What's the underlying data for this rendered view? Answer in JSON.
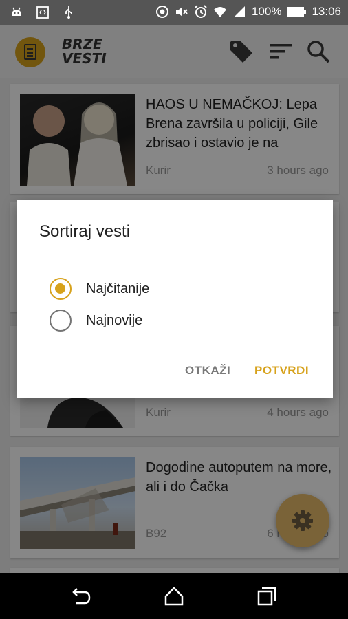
{
  "status_bar": {
    "battery": "100%",
    "time": "13:06",
    "icons": [
      "android-debug-icon",
      "code-icon",
      "usb-icon",
      "data-saver-icon",
      "mute-icon",
      "alarm-icon",
      "wifi-icon",
      "signal-icon",
      "battery-icon"
    ]
  },
  "app_bar": {
    "brand_line1": "BRZE",
    "brand_line2": "VESTI",
    "icons": [
      "app-logo-icon",
      "tag-icon",
      "sort-icon",
      "search-icon"
    ]
  },
  "feed": {
    "items": [
      {
        "headline": "HAOS U NEMAČKOJ: Lepa Brena završila u policiji, Gile zbrisao i ostavio je na",
        "source": "Kurir",
        "time": "3 hours ago"
      },
      {
        "headline": "",
        "source": "Kurir",
        "time": "4 hours ago"
      },
      {
        "headline": "Dogodine autoputem na more, ali i do Čačka",
        "source": "B92",
        "time": "6 hours ago"
      }
    ]
  },
  "dialog": {
    "title": "Sortiraj vesti",
    "options": [
      {
        "label": "Najčitanije",
        "selected": true
      },
      {
        "label": "Najnovije",
        "selected": false
      }
    ],
    "cancel_label": "OTKAŽI",
    "confirm_label": "POTVRDI"
  },
  "fab": {
    "icon": "settings-icon"
  },
  "nav_bar": {
    "icons": [
      "back-icon",
      "home-icon",
      "recents-icon"
    ]
  },
  "colors": {
    "accent": "#d7a21c",
    "status_bar": "#555555",
    "app_bar": "#f2f2f2",
    "scrim": "rgba(0,0,0,0.47)"
  }
}
